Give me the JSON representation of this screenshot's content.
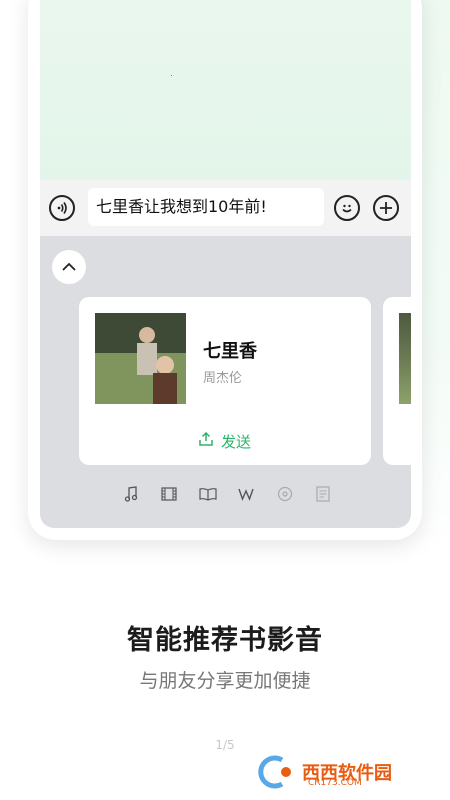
{
  "chat": {
    "input_text": "七里香让我想到10年前!"
  },
  "icons": {
    "voice": "voice-icon",
    "emoji": "emoji-icon",
    "plus": "plus-icon",
    "collapse": "chevron-up-icon",
    "send": "share-icon"
  },
  "recommend_card": {
    "title": "七里香",
    "artist": "周杰伦",
    "send_label": "发送"
  },
  "panel_tabs": [
    {
      "name": "music-tab-icon"
    },
    {
      "name": "film-tab-icon"
    },
    {
      "name": "book-tab-icon"
    },
    {
      "name": "w-tab-icon"
    },
    {
      "name": "disc-tab-icon"
    },
    {
      "name": "document-tab-icon"
    }
  ],
  "intro": {
    "headline": "智能推荐书影音",
    "subline": "与朋友分享更加便捷",
    "pager": "1/5"
  },
  "watermark": {
    "brand": "西西软件园",
    "domain": "CR173.COM"
  },
  "colors": {
    "accent": "#2fb36b",
    "panel_bg": "#dcdde0",
    "chat_bg": "#e3f5ea"
  }
}
